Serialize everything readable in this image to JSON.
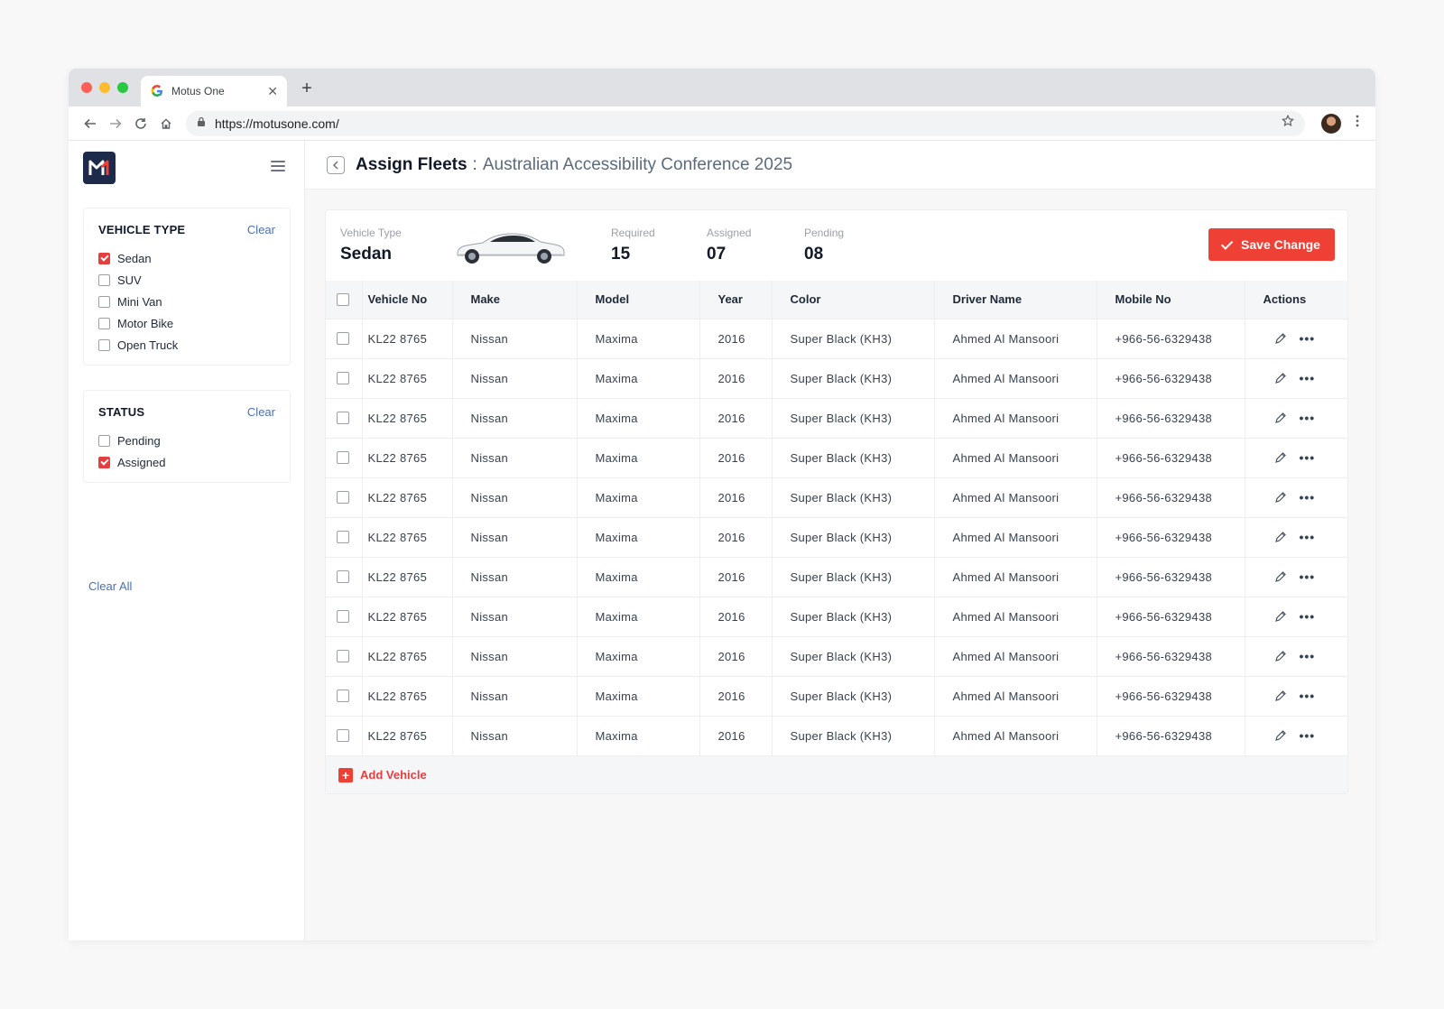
{
  "browser": {
    "tab_title": "Motus One",
    "tab_close": "✕",
    "new_tab": "+",
    "url": "https://motusone.com/"
  },
  "colors": {
    "accent": "#ef4036",
    "link": "#4a6fb5",
    "logo_bg": "#1e2a4a"
  },
  "sidebar": {
    "vehicle_type": {
      "title": "VEHICLE TYPE",
      "clear": "Clear",
      "items": [
        {
          "label": "Sedan",
          "checked": true
        },
        {
          "label": "SUV",
          "checked": false
        },
        {
          "label": "Mini Van",
          "checked": false
        },
        {
          "label": "Motor Bike",
          "checked": false
        },
        {
          "label": "Open Truck",
          "checked": false
        }
      ]
    },
    "status": {
      "title": "STATUS",
      "clear": "Clear",
      "items": [
        {
          "label": "Pending",
          "checked": false
        },
        {
          "label": "Assigned",
          "checked": true
        }
      ]
    },
    "clear_all": "Clear All"
  },
  "header": {
    "title": "Assign Fleets",
    "separator": ":",
    "subtitle": "Australian Accessibility Conference 2025"
  },
  "summary": {
    "vehicle_type_label": "Vehicle Type",
    "vehicle_type_value": "Sedan",
    "required_label": "Required",
    "required_value": "15",
    "assigned_label": "Assigned",
    "assigned_value": "07",
    "pending_label": "Pending",
    "pending_value": "08",
    "save_label": "Save Change"
  },
  "table": {
    "columns": [
      "Vehicle No",
      "Make",
      "Model",
      "Year",
      "Color",
      "Driver Name",
      "Mobile No",
      "Actions"
    ],
    "rows": [
      [
        "KL22 8765",
        "Nissan",
        "Maxima",
        "2016",
        "Super Black (KH3)",
        "Ahmed Al Mansoori",
        "+966-56-6329438"
      ],
      [
        "KL22 8765",
        "Nissan",
        "Maxima",
        "2016",
        "Super Black (KH3)",
        "Ahmed Al Mansoori",
        "+966-56-6329438"
      ],
      [
        "KL22 8765",
        "Nissan",
        "Maxima",
        "2016",
        "Super Black (KH3)",
        "Ahmed Al Mansoori",
        "+966-56-6329438"
      ],
      [
        "KL22 8765",
        "Nissan",
        "Maxima",
        "2016",
        "Super Black (KH3)",
        "Ahmed Al Mansoori",
        "+966-56-6329438"
      ],
      [
        "KL22 8765",
        "Nissan",
        "Maxima",
        "2016",
        "Super Black (KH3)",
        "Ahmed Al Mansoori",
        "+966-56-6329438"
      ],
      [
        "KL22 8765",
        "Nissan",
        "Maxima",
        "2016",
        "Super Black (KH3)",
        "Ahmed Al Mansoori",
        "+966-56-6329438"
      ],
      [
        "KL22 8765",
        "Nissan",
        "Maxima",
        "2016",
        "Super Black (KH3)",
        "Ahmed Al Mansoori",
        "+966-56-6329438"
      ],
      [
        "KL22 8765",
        "Nissan",
        "Maxima",
        "2016",
        "Super Black (KH3)",
        "Ahmed Al Mansoori",
        "+966-56-6329438"
      ],
      [
        "KL22 8765",
        "Nissan",
        "Maxima",
        "2016",
        "Super Black (KH3)",
        "Ahmed Al Mansoori",
        "+966-56-6329438"
      ],
      [
        "KL22 8765",
        "Nissan",
        "Maxima",
        "2016",
        "Super Black (KH3)",
        "Ahmed Al Mansoori",
        "+966-56-6329438"
      ],
      [
        "KL22 8765",
        "Nissan",
        "Maxima",
        "2016",
        "Super Black (KH3)",
        "Ahmed Al Mansoori",
        "+966-56-6329438"
      ]
    ],
    "more_glyph": "•••",
    "add_vehicle": "Add Vehicle"
  }
}
